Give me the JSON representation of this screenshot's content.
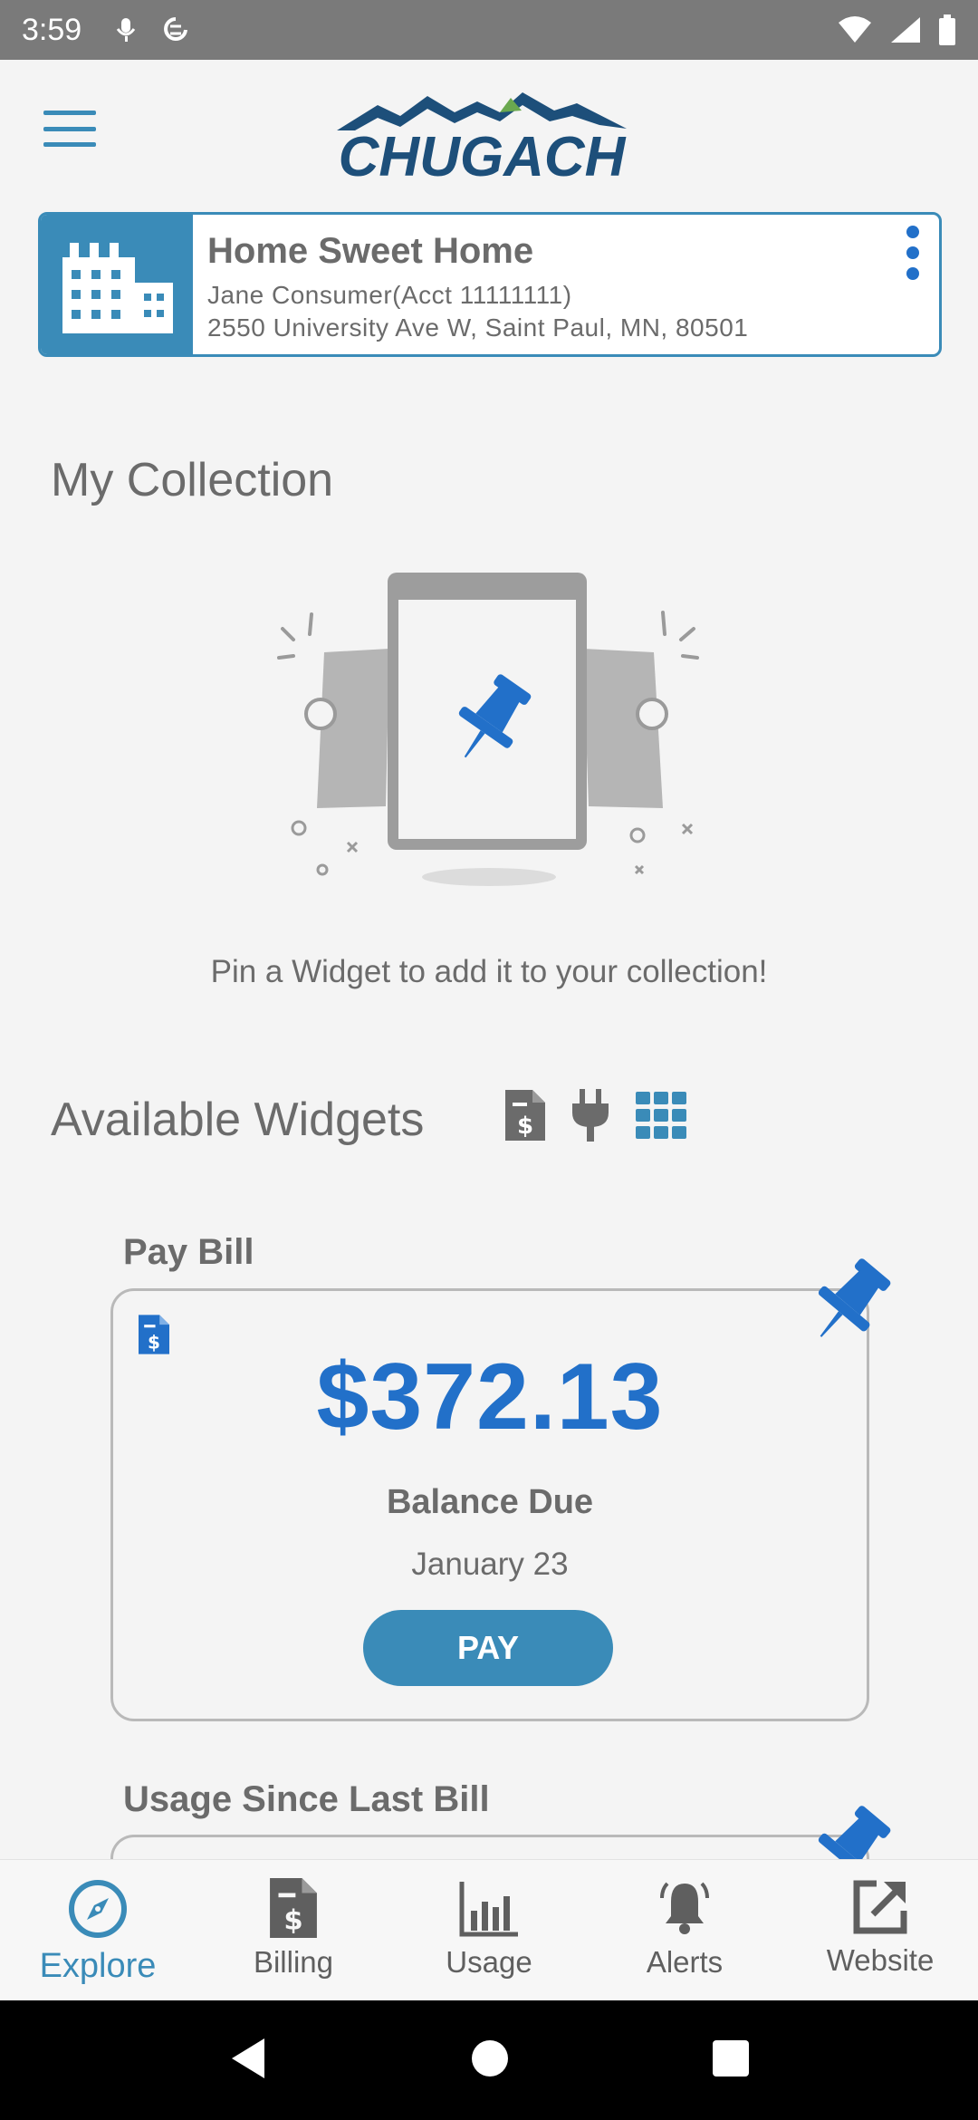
{
  "status_bar": {
    "time": "3:59"
  },
  "brand": {
    "logo_text": "CHUGACH",
    "accent": "#3a8bb8",
    "link": "#2270c9"
  },
  "account": {
    "name": "Home Sweet Home",
    "holder": "Jane Consumer(Acct 11111111)",
    "address": "2550 University Ave W, Saint Paul, MN, 80501"
  },
  "collection": {
    "title": "My Collection",
    "empty_message": "Pin a Widget to add it to your collection!"
  },
  "widgets": {
    "title": "Available Widgets",
    "filters": [
      "billing-doc-icon",
      "plug-icon",
      "grid-icon"
    ],
    "pay_bill": {
      "label": "Pay Bill",
      "amount": "$372.13",
      "balance_label": "Balance Due",
      "due_date": "January 23",
      "pay_label": "PAY"
    },
    "usage": {
      "label": "Usage Since Last Bill"
    }
  },
  "nav": {
    "items": [
      {
        "label": "Explore",
        "icon": "compass-icon"
      },
      {
        "label": "Billing",
        "icon": "bill-icon"
      },
      {
        "label": "Usage",
        "icon": "bar-chart-icon"
      },
      {
        "label": "Alerts",
        "icon": "bell-icon"
      },
      {
        "label": "Website",
        "icon": "external-link-icon"
      }
    ]
  }
}
